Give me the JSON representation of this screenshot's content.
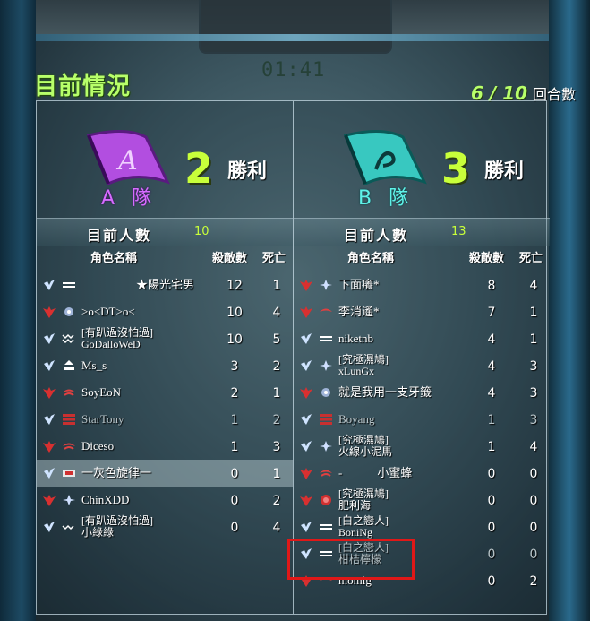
{
  "header": {
    "title": "目前情況",
    "timer": "01:41",
    "round": "6 / 10",
    "round_label": "回合數"
  },
  "wins_label": "勝利",
  "count_label": "目前人數",
  "columns": {
    "name": "角色名稱",
    "kills": "殺敵數",
    "deaths": "死亡"
  },
  "colors": {
    "team_a": "#d66cff",
    "team_b": "#5ff2e8",
    "accent": "#b8ff6a",
    "highlight_box": "#e01818"
  },
  "team_a": {
    "name": "A 隊",
    "wins": "2",
    "count": "10",
    "players": [
      {
        "name": "★陽光宅男",
        "kills": "12",
        "deaths": "1"
      },
      {
        "name": ">o<DT>o<",
        "kills": "10",
        "deaths": "4"
      },
      {
        "guild": "[有趴過沒怕過]",
        "name": "GoDalloWeD",
        "kills": "10",
        "deaths": "5"
      },
      {
        "name": "Ms_s",
        "kills": "3",
        "deaths": "2"
      },
      {
        "name": "SoyEoN",
        "kills": "2",
        "deaths": "1"
      },
      {
        "name": "StarTony",
        "kills": "1",
        "deaths": "2"
      },
      {
        "name": "Diceso",
        "kills": "1",
        "deaths": "3"
      },
      {
        "name": "一灰色旋律一",
        "kills": "0",
        "deaths": "1"
      },
      {
        "name": "ChinXDD",
        "kills": "0",
        "deaths": "2"
      },
      {
        "guild": "[有趴過沒怕過]",
        "name": "小綠綠",
        "kills": "0",
        "deaths": "4"
      }
    ]
  },
  "team_b": {
    "name": "B 隊",
    "wins": "3",
    "count": "13",
    "players": [
      {
        "name": "下面癢*",
        "kills": "8",
        "deaths": "4"
      },
      {
        "name": "李消遙*",
        "kills": "7",
        "deaths": "1"
      },
      {
        "name": "niketnb",
        "kills": "4",
        "deaths": "1"
      },
      {
        "guild": "[究極濕鳩]",
        "name": "xLunGx",
        "kills": "4",
        "deaths": "3"
      },
      {
        "name": "就是我用一支牙籤",
        "kills": "4",
        "deaths": "3"
      },
      {
        "name": "Boyang",
        "kills": "1",
        "deaths": "3"
      },
      {
        "guild": "[究極濕鳩]",
        "name": "火線小泥馬",
        "kills": "1",
        "deaths": "4"
      },
      {
        "name": "-　　　小蜜蜂",
        "kills": "0",
        "deaths": "0"
      },
      {
        "guild": "[究極濕鳩]",
        "name": "肥利海",
        "kills": "0",
        "deaths": "0"
      },
      {
        "guild": "[白之戀人]",
        "name": "BoniNg",
        "kills": "0",
        "deaths": "0"
      },
      {
        "guild": "[白之戀人]",
        "name": "柑桔檸檬",
        "kills": "0",
        "deaths": "0"
      },
      {
        "name": "momig",
        "kills": "0",
        "deaths": "2"
      }
    ]
  }
}
